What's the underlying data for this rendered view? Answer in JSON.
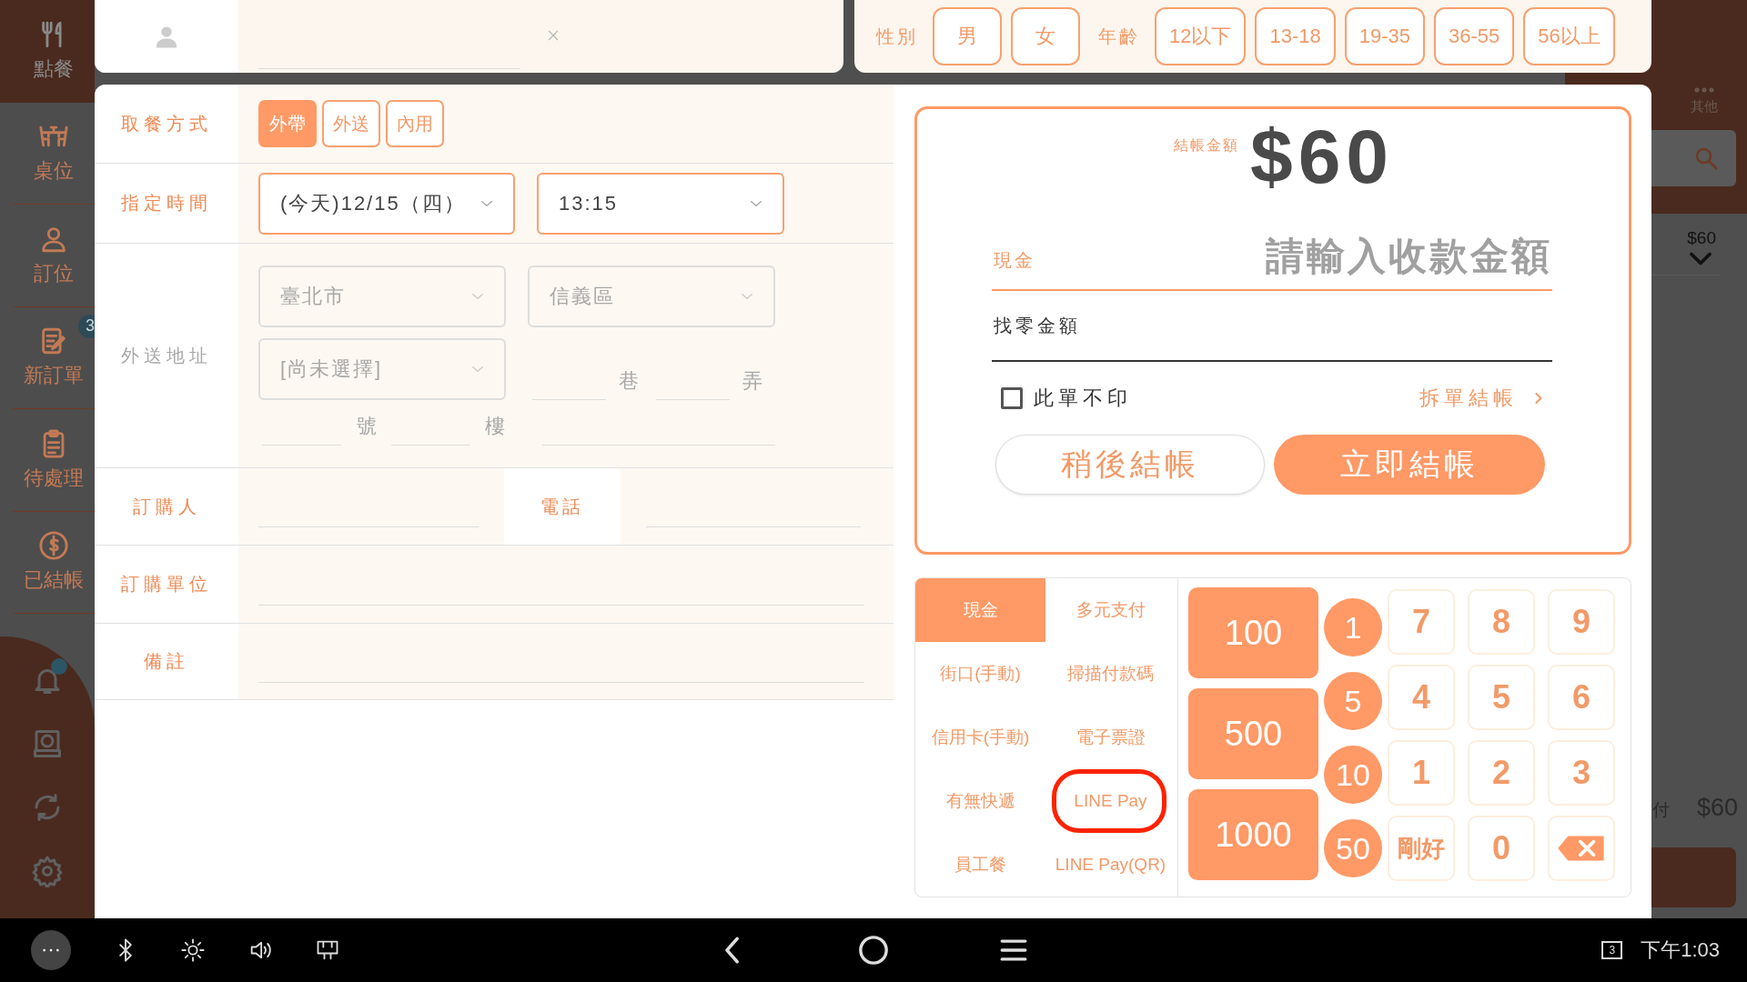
{
  "sidebar": {
    "items": [
      {
        "label": "點餐",
        "selected": true
      },
      {
        "label": "桌位",
        "selected": false
      },
      {
        "label": "訂位",
        "selected": false
      },
      {
        "label": "新訂單",
        "selected": false,
        "badge": "3"
      },
      {
        "label": "待處理",
        "selected": false
      },
      {
        "label": "已結帳",
        "selected": false
      }
    ]
  },
  "background": {
    "other": "其他",
    "order_total": "$60",
    "due_label": "付",
    "due": "$60"
  },
  "gender": {
    "label": "性別",
    "options": [
      {
        "label": "男",
        "selected": false
      },
      {
        "label": "女",
        "selected": false
      }
    ]
  },
  "age": {
    "label": "年齡",
    "options": [
      {
        "label": "12以下",
        "selected": false
      },
      {
        "label": "13-18",
        "selected": false
      },
      {
        "label": "19-35",
        "selected": false
      },
      {
        "label": "36-55",
        "selected": false
      },
      {
        "label": "56以上",
        "selected": false
      }
    ]
  },
  "pickup": {
    "label": "取餐方式",
    "options": [
      {
        "label": "外帶",
        "selected": true
      },
      {
        "label": "外送",
        "selected": false
      },
      {
        "label": "內用",
        "selected": false
      }
    ]
  },
  "time": {
    "label": "指定時間",
    "date": "(今天)12/15（四）",
    "time": "13:15"
  },
  "address": {
    "label": "外送地址",
    "disabled": true,
    "city": "臺北市",
    "district": "信義區",
    "road": "[尚未選擇]",
    "lane": "巷",
    "alley": "弄",
    "number": "號",
    "floor": "樓"
  },
  "buyer": {
    "label": "訂購人",
    "phone_label": "電話"
  },
  "company": {
    "label": "訂購單位"
  },
  "note": {
    "label": "備註"
  },
  "checkout": {
    "total_label": "結帳金額",
    "total": "$60",
    "cash_label": "現金",
    "cash_placeholder": "請輸入收款金額",
    "change_label": "找零金額",
    "no_print": {
      "label": "此單不印",
      "checked": false
    },
    "split": "拆單結帳",
    "later": "稍後結帳",
    "now": "立即結帳"
  },
  "payment_methods": [
    {
      "label": "現金",
      "selected": true,
      "highlighted": false
    },
    {
      "label": "多元支付",
      "selected": false,
      "highlighted": false
    },
    {
      "label": "街口(手動)",
      "selected": false,
      "highlighted": false
    },
    {
      "label": "掃描付款碼",
      "selected": false,
      "highlighted": false
    },
    {
      "label": "信用卡(手動)",
      "selected": false,
      "highlighted": false
    },
    {
      "label": "電子票證",
      "selected": false,
      "highlighted": false
    },
    {
      "label": "有無快遞",
      "selected": false,
      "highlighted": false
    },
    {
      "label": "LINE Pay",
      "selected": false,
      "highlighted": true
    },
    {
      "label": "員工餐",
      "selected": false,
      "highlighted": false
    },
    {
      "label": "LINE Pay(QR)",
      "selected": false,
      "highlighted": false
    }
  ],
  "quick_amounts": [
    "100",
    "500",
    "1000"
  ],
  "coins": [
    "1",
    "5",
    "10",
    "50"
  ],
  "keypad": [
    {
      "kind": "key",
      "label": "7"
    },
    {
      "kind": "key",
      "label": "8"
    },
    {
      "kind": "key",
      "label": "9"
    },
    {
      "kind": "key",
      "label": "4"
    },
    {
      "kind": "key",
      "label": "5"
    },
    {
      "kind": "key",
      "label": "6"
    },
    {
      "kind": "key",
      "label": "1"
    },
    {
      "kind": "key",
      "label": "2"
    },
    {
      "kind": "key",
      "label": "3"
    },
    {
      "kind": "key",
      "label": "剛好"
    },
    {
      "kind": "key",
      "label": "0"
    },
    {
      "kind": "backspace"
    }
  ],
  "status_bar": {
    "screen_count": "3",
    "time": "下午1:03"
  }
}
